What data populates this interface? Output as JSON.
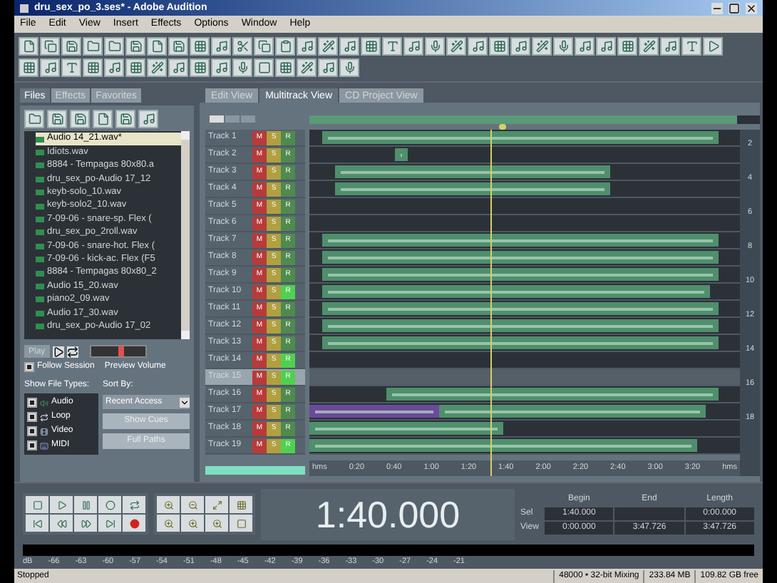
{
  "window": {
    "title": "dru_sex_po_3.ses* - Adobe Audition"
  },
  "menu": [
    "File",
    "Edit",
    "View",
    "Insert",
    "Effects",
    "Options",
    "Window",
    "Help"
  ],
  "panel_tabs": [
    {
      "label": "Files",
      "selected": true
    },
    {
      "label": "Effects",
      "selected": false
    },
    {
      "label": "Favorites",
      "selected": false
    }
  ],
  "files": [
    {
      "name": "Audio 14_21.wav*",
      "selected": true
    },
    {
      "name": "Idiots.wav",
      "selected": false
    },
    {
      "name": "8884 - Tempagas 80x80.a",
      "selected": false
    },
    {
      "name": "dru_sex_po-Audio 17_12",
      "selected": false
    },
    {
      "name": "keyb-solo_10.wav",
      "selected": false
    },
    {
      "name": "keyb-solo2_10.wav",
      "selected": false
    },
    {
      "name": "7-09-06 - snare-sp. Flex (",
      "selected": false
    },
    {
      "name": "dru_sex_po_2roll.wav",
      "selected": false
    },
    {
      "name": "7-09-06 - snare-hot. Flex (",
      "selected": false
    },
    {
      "name": "7-09-06 - kick-ac. Flex (F5",
      "selected": false
    },
    {
      "name": "8884 - Tempagas 80x80_2",
      "selected": false
    },
    {
      "name": "Audio 15_20.wav",
      "selected": false
    },
    {
      "name": "piano2_09.wav",
      "selected": false
    },
    {
      "name": "Audio 17_30.wav",
      "selected": false
    },
    {
      "name": "dru_sex_po-Audio 17_02",
      "selected": false
    }
  ],
  "preview": {
    "play_label": "Play",
    "follow_session": {
      "label": "Follow Session",
      "checked": true
    },
    "volume_label": "Preview Volume",
    "level": 0.55
  },
  "file_types": {
    "label": "Show File Types:",
    "items": [
      {
        "label": "Audio",
        "checked": true
      },
      {
        "label": "Loop",
        "checked": true
      },
      {
        "label": "Video",
        "checked": true
      },
      {
        "label": "MIDI",
        "checked": true
      }
    ]
  },
  "sort": {
    "label": "Sort By:",
    "value": "Recent Access",
    "buttons": [
      "Show Cues",
      "Full Paths"
    ]
  },
  "view_tabs": [
    {
      "label": "Edit View",
      "selected": false
    },
    {
      "label": "Multitrack View",
      "selected": true
    },
    {
      "label": "CD Project View",
      "selected": false
    }
  ],
  "tracks": [
    {
      "name": "Track 1",
      "armed": false,
      "selected": false
    },
    {
      "name": "Track 2",
      "armed": false,
      "selected": false
    },
    {
      "name": "Track 3",
      "armed": false,
      "selected": false
    },
    {
      "name": "Track 4",
      "armed": false,
      "selected": false
    },
    {
      "name": "Track 5",
      "armed": false,
      "selected": false
    },
    {
      "name": "Track 6",
      "armed": false,
      "selected": false
    },
    {
      "name": "Track 7",
      "armed": false,
      "selected": false
    },
    {
      "name": "Track 8",
      "armed": false,
      "selected": false
    },
    {
      "name": "Track 9",
      "armed": false,
      "selected": false
    },
    {
      "name": "Track 10",
      "armed": true,
      "selected": false
    },
    {
      "name": "Track 11",
      "armed": false,
      "selected": false
    },
    {
      "name": "Track 12",
      "armed": false,
      "selected": false
    },
    {
      "name": "Track 13",
      "armed": false,
      "selected": false
    },
    {
      "name": "Track 14",
      "armed": true,
      "selected": false
    },
    {
      "name": "Track 15",
      "armed": true,
      "selected": true
    },
    {
      "name": "Track 16",
      "armed": false,
      "selected": false
    },
    {
      "name": "Track 17",
      "armed": false,
      "selected": false
    },
    {
      "name": "Track 18",
      "armed": false,
      "selected": false
    },
    {
      "name": "Track 19",
      "armed": true,
      "selected": false
    }
  ],
  "track_buttons": [
    [
      "M",
      "S",
      "R"
    ],
    [
      "M",
      "S",
      "R"
    ],
    [
      "M",
      "S",
      "R"
    ],
    [
      "M",
      "S",
      "R"
    ],
    [
      "M",
      "S",
      "R"
    ],
    [
      "M",
      "S",
      "R"
    ],
    [
      "M",
      "S",
      "R"
    ],
    [
      "M",
      "S",
      "R"
    ],
    [
      "M",
      "S",
      "R"
    ],
    [
      "M",
      "S",
      "R"
    ],
    [
      "M",
      "S",
      "R"
    ],
    [
      "M",
      "S",
      "R"
    ],
    [
      "M",
      "S",
      "R"
    ],
    [
      "M",
      "S",
      "R"
    ],
    [
      "M",
      "S",
      "R"
    ],
    [
      "M",
      "S",
      "R"
    ],
    [
      "M",
      "S",
      "R"
    ],
    [
      "M",
      "S",
      "R"
    ],
    [
      "M",
      "S",
      "R"
    ]
  ],
  "ruler": [
    "hms",
    "0:20",
    "0:40",
    "1:00",
    "1:20",
    "1:40",
    "2:00",
    "2:20",
    "2:40",
    "3:00",
    "3:20",
    "hms"
  ],
  "track_scale": [
    "2",
    "4",
    "6",
    "8",
    "10",
    "12",
    "14",
    "16",
    "18"
  ],
  "time_display": "1:40.000",
  "selection": {
    "columns": [
      "Begin",
      "End",
      "Length"
    ],
    "rows": [
      {
        "label": "Sel",
        "begin": "1:40.000",
        "length": "0:00.000"
      },
      {
        "label": "View",
        "begin": "0:00.000",
        "end": "3:47.726",
        "length": "3:47.726"
      }
    ]
  },
  "meter_scale": [
    "dB",
    "-66",
    "-63",
    "-60",
    "-57",
    "-54",
    "-51",
    "-48",
    "-45",
    "-42",
    "-39",
    "-36",
    "-33",
    "-30",
    "-27",
    "-24",
    "-21"
  ],
  "status_bar": [
    "Stopped",
    "48000 • 32-bit Mixing",
    "233.84 MB",
    "109.82 GB free"
  ]
}
